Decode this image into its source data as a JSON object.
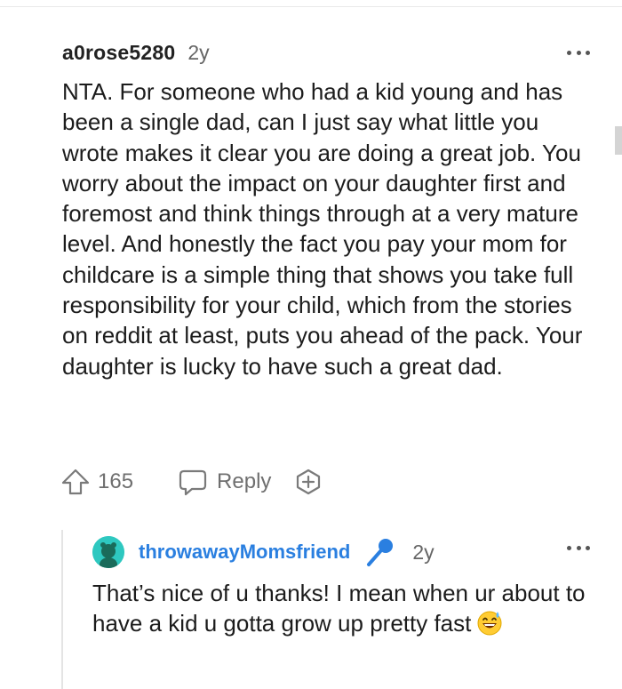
{
  "comment": {
    "username": "a0rose5280",
    "age": "2y",
    "body": "NTA. For someone who had a kid young and has been a single dad, can I just say what little you wrote makes it clear you are doing a great job. You worry about the impact on your daughter first and foremost and think things through at a very mature level. And honestly the fact you pay your mom for childcare is a simple thing that shows you take full responsibility for your child, which from the stories on reddit at least, puts you ahead of the pack. Your daughter is lucky to have such a great dad.",
    "vote_count": "165",
    "reply_label": "Reply"
  },
  "reply": {
    "username": "throwawayMomsfriend",
    "age": "2y",
    "body": "That’s nice of u thanks! I mean when ur about to have a kid u gotta grow up pretty fast"
  },
  "icons": {
    "upvote": "upvote-arrow-icon",
    "reply": "speech-bubble-icon",
    "award": "award-plus-icon",
    "more": "ellipsis-icon",
    "mic": "microphone-icon",
    "emoji": "grinning-sweat-emoji"
  },
  "colors": {
    "username_link": "#2a7fe0",
    "avatar_bg": "#2ec8c0",
    "muted_text": "#6f6f6f"
  }
}
